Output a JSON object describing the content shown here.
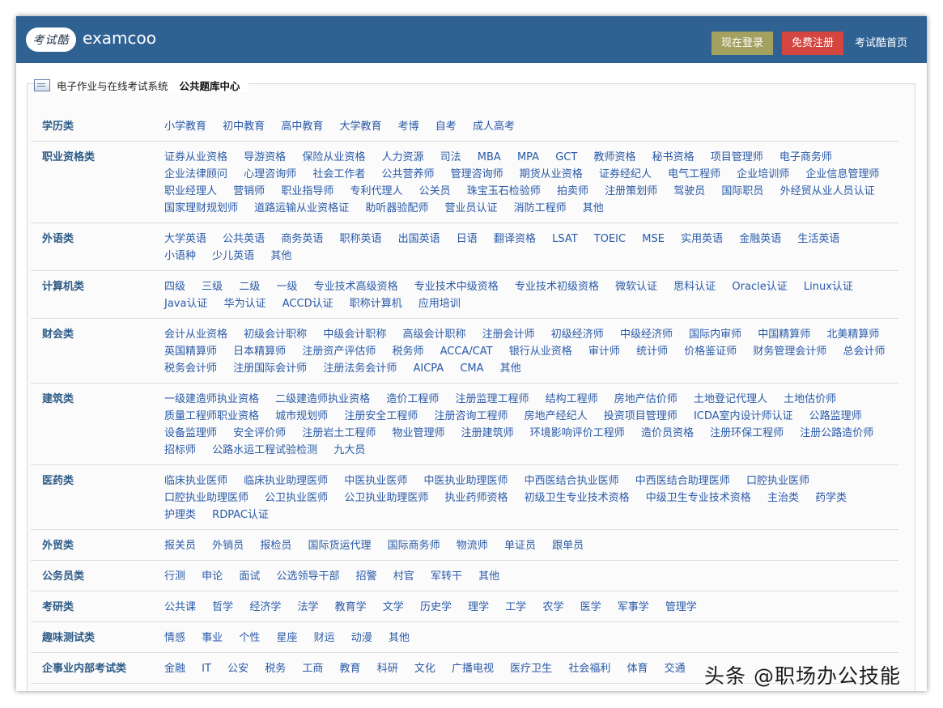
{
  "header": {
    "logo_text": "考试酷",
    "brand": "examcoo",
    "login_label": "现在登录",
    "register_label": "免费注册",
    "home_label": "考试酷首页"
  },
  "breadcrumb": {
    "root": "电子作业与在线考试系统",
    "current": "公共题库中心"
  },
  "categories": [
    {
      "title": "学历类",
      "links": [
        "小学教育",
        "初中教育",
        "高中教育",
        "大学教育",
        "考博",
        "自考",
        "成人高考"
      ]
    },
    {
      "title": "职业资格类",
      "links": [
        "证券从业资格",
        "导游资格",
        "保险从业资格",
        "人力资源",
        "司法",
        "MBA",
        "MPA",
        "GCT",
        "教师资格",
        "秘书资格",
        "项目管理师",
        "电子商务师",
        "企业法律顾问",
        "心理咨询师",
        "社会工作者",
        "公共营养师",
        "管理咨询师",
        "期货从业资格",
        "证券经纪人",
        "电气工程师",
        "企业培训师",
        "企业信息管理师",
        "职业经理人",
        "营销师",
        "职业指导师",
        "专利代理人",
        "公关员",
        "珠宝玉石检验师",
        "拍卖师",
        "注册策划师",
        "驾驶员",
        "国际职员",
        "外经贸从业人员认证",
        "国家理财规划师",
        "道路运输从业资格证",
        "助听器验配师",
        "营业员认证",
        "消防工程师",
        "其他"
      ]
    },
    {
      "title": "外语类",
      "links": [
        "大学英语",
        "公共英语",
        "商务英语",
        "职称英语",
        "出国英语",
        "日语",
        "翻译资格",
        "LSAT",
        "TOEIC",
        "MSE",
        "实用英语",
        "金融英语",
        "生活英语",
        "小语种",
        "少儿英语",
        "其他"
      ]
    },
    {
      "title": "计算机类",
      "links": [
        "四级",
        "三级",
        "二级",
        "一级",
        "专业技术高级资格",
        "专业技术中级资格",
        "专业技术初级资格",
        "微软认证",
        "思科认证",
        "Oracle认证",
        "Linux认证",
        "Java认证",
        "华为认证",
        "ACCD认证",
        "职称计算机",
        "应用培训"
      ]
    },
    {
      "title": "财会类",
      "links": [
        "会计从业资格",
        "初级会计职称",
        "中级会计职称",
        "高级会计职称",
        "注册会计师",
        "初级经济师",
        "中级经济师",
        "国际内审师",
        "中国精算师",
        "北美精算师",
        "英国精算师",
        "日本精算师",
        "注册资产评估师",
        "税务师",
        "ACCA/CAT",
        "银行从业资格",
        "审计师",
        "统计师",
        "价格鉴证师",
        "财务管理会计师",
        "总会计师",
        "税务会计师",
        "注册国际会计师",
        "注册法务会计师",
        "AICPA",
        "CMA",
        "其他"
      ]
    },
    {
      "title": "建筑类",
      "links": [
        "一级建造师执业资格",
        "二级建造师执业资格",
        "造价工程师",
        "注册监理工程师",
        "结构工程师",
        "房地产估价师",
        "土地登记代理人",
        "土地估价师",
        "质量工程师职业资格",
        "城市规划师",
        "注册安全工程师",
        "注册咨询工程师",
        "房地产经纪人",
        "投资项目管理师",
        "ICDA室内设计师认证",
        "公路监理师",
        "设备监理师",
        "安全评价师",
        "注册岩土工程师",
        "物业管理师",
        "注册建筑师",
        "环境影响评价工程师",
        "造价员资格",
        "注册环保工程师",
        "注册公路造价师",
        "招标师",
        "公路水运工程试验检测",
        "九大员"
      ]
    },
    {
      "title": "医药类",
      "links": [
        "临床执业医师",
        "临床执业助理医师",
        "中医执业医师",
        "中医执业助理医师",
        "中西医结合执业医师",
        "中西医结合助理医师",
        "口腔执业医师",
        "口腔执业助理医师",
        "公卫执业医师",
        "公卫执业助理医师",
        "执业药师资格",
        "初级卫生专业技术资格",
        "中级卫生专业技术资格",
        "主治类",
        "药学类",
        "护理类",
        "RDPAC认证"
      ]
    },
    {
      "title": "外贸类",
      "links": [
        "报关员",
        "外销员",
        "报检员",
        "国际货运代理",
        "国际商务师",
        "物流师",
        "单证员",
        "跟单员"
      ]
    },
    {
      "title": "公务员类",
      "links": [
        "行测",
        "申论",
        "面试",
        "公选领导干部",
        "招警",
        "村官",
        "军转干",
        "其他"
      ]
    },
    {
      "title": "考研类",
      "links": [
        "公共课",
        "哲学",
        "经济学",
        "法学",
        "教育学",
        "文学",
        "历史学",
        "理学",
        "工学",
        "农学",
        "医学",
        "军事学",
        "管理学"
      ]
    },
    {
      "title": "趣味测试类",
      "links": [
        "情感",
        "事业",
        "个性",
        "星座",
        "财运",
        "动漫",
        "其他"
      ]
    },
    {
      "title": "企事业内部考试类",
      "links": [
        "金融",
        "IT",
        "公安",
        "税务",
        "工商",
        "教育",
        "科研",
        "文化",
        "广播电视",
        "医疗卫生",
        "社会福利",
        "体育",
        "交通"
      ]
    }
  ],
  "watermark": "头条 @职场办公技能",
  "colors": {
    "header_bg": "#2f6193",
    "login_bg": "#a4a060",
    "register_bg": "#d4453f",
    "category_title": "#2d5b87",
    "link": "#2a5aa8"
  }
}
